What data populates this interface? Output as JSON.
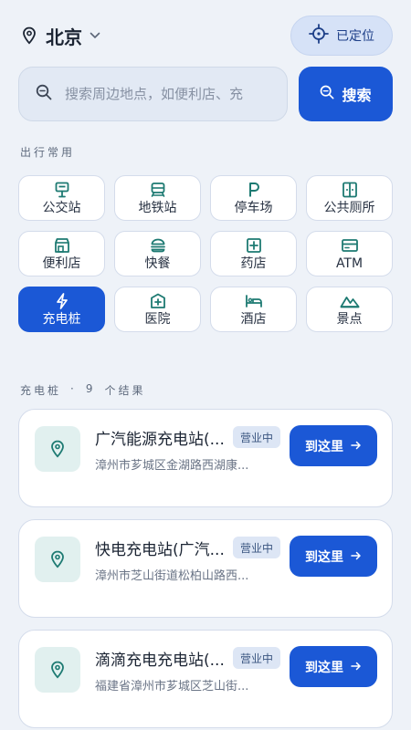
{
  "header": {
    "city": "北京",
    "locate_label": "已定位"
  },
  "search": {
    "placeholder": "搜索周边地点，如便利店、充",
    "button_label": "搜索"
  },
  "frequent": {
    "title": "出行常用",
    "categories": [
      {
        "label": "公交站",
        "icon": "bus-stop-icon",
        "active": false
      },
      {
        "label": "地铁站",
        "icon": "subway-icon",
        "active": false
      },
      {
        "label": "停车场",
        "icon": "parking-icon",
        "active": false
      },
      {
        "label": "公共厕所",
        "icon": "restroom-icon",
        "active": false
      },
      {
        "label": "便利店",
        "icon": "store-icon",
        "active": false
      },
      {
        "label": "快餐",
        "icon": "fast-food-icon",
        "active": false
      },
      {
        "label": "药店",
        "icon": "pharmacy-icon",
        "active": false
      },
      {
        "label": "ATM",
        "icon": "atm-icon",
        "active": false
      },
      {
        "label": "充电桩",
        "icon": "charging-icon",
        "active": true
      },
      {
        "label": "医院",
        "icon": "hospital-icon",
        "active": false
      },
      {
        "label": "酒店",
        "icon": "hotel-icon",
        "active": false
      },
      {
        "label": "景点",
        "icon": "scenic-icon",
        "active": false
      }
    ]
  },
  "results": {
    "category": "充电桩",
    "separator": "·",
    "count": "9",
    "count_suffix": "个结果",
    "items": [
      {
        "name": "广汽能源充电站(...",
        "status": "营业中",
        "address": "漳州市芗城区金湖路西湖康...",
        "action": "到这里"
      },
      {
        "name": "快电充电站(广汽...",
        "status": "营业中",
        "address": "漳州市芝山街道松柏山路西...",
        "action": "到这里"
      },
      {
        "name": "滴滴充电充电站(...",
        "status": "营业中",
        "address": "福建省漳州市芗城区芝山街...",
        "action": "到这里"
      }
    ]
  },
  "colors": {
    "background": "#eef2f8",
    "accent": "#1b58d6",
    "icon_teal": "#1d7a72"
  }
}
